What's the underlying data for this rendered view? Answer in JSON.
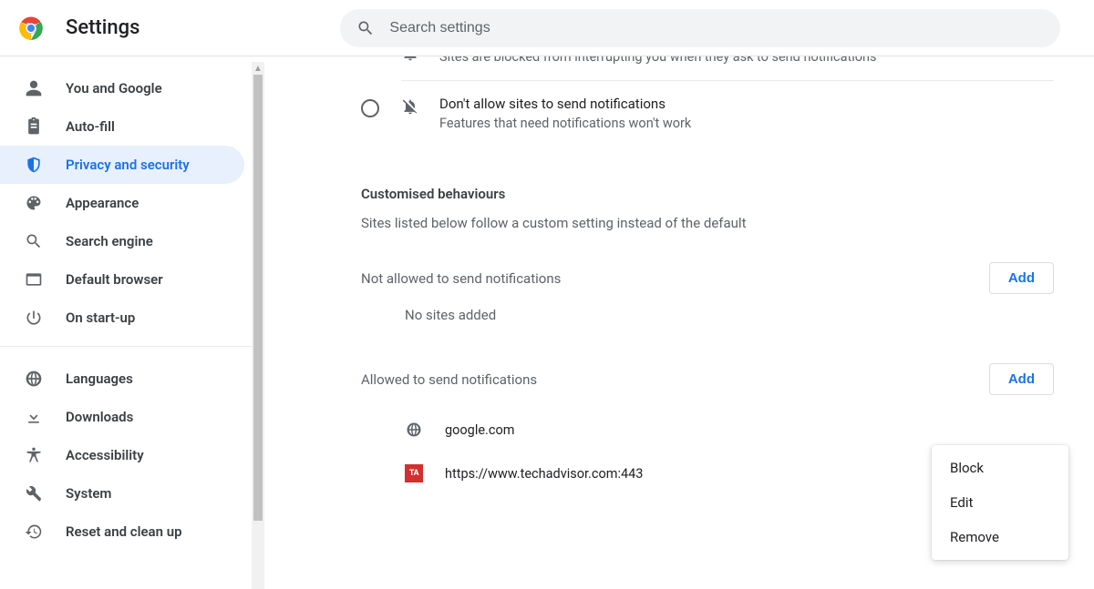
{
  "header": {
    "title": "Settings",
    "search_placeholder": "Search settings"
  },
  "sidebar": {
    "groups": [
      [
        {
          "icon": "person",
          "label": "You and Google",
          "active": false
        },
        {
          "icon": "clipboard",
          "label": "Auto-fill",
          "active": false
        },
        {
          "icon": "shield",
          "label": "Privacy and security",
          "active": true
        },
        {
          "icon": "palette",
          "label": "Appearance",
          "active": false
        },
        {
          "icon": "search",
          "label": "Search engine",
          "active": false
        },
        {
          "icon": "window",
          "label": "Default browser",
          "active": false
        },
        {
          "icon": "power",
          "label": "On start-up",
          "active": false
        }
      ],
      [
        {
          "icon": "globe",
          "label": "Languages",
          "active": false
        },
        {
          "icon": "download",
          "label": "Downloads",
          "active": false
        },
        {
          "icon": "accessibility",
          "label": "Accessibility",
          "active": false
        },
        {
          "icon": "wrench",
          "label": "System",
          "active": false
        },
        {
          "icon": "restore",
          "label": "Reset and clean up",
          "active": false
        }
      ]
    ]
  },
  "main": {
    "options": [
      {
        "title": "",
        "desc": "Sites are blocked from interrupting you when they ask to send notifications",
        "icon": "bell"
      },
      {
        "title": "Don't allow sites to send notifications",
        "desc": "Features that need notifications won't work",
        "icon": "bell-off"
      }
    ],
    "custom_heading": "Customised behaviours",
    "custom_sub": "Sites listed below follow a custom setting instead of the default",
    "not_allowed": {
      "label": "Not allowed to send notifications",
      "add": "Add",
      "empty": "No sites added"
    },
    "allowed": {
      "label": "Allowed to send notifications",
      "add": "Add",
      "sites": [
        {
          "icon": "globe",
          "name": "google.com"
        },
        {
          "icon": "ta",
          "name": "https://www.techadvisor.com:443"
        }
      ]
    }
  },
  "popup": {
    "items": [
      "Block",
      "Edit",
      "Remove"
    ]
  }
}
